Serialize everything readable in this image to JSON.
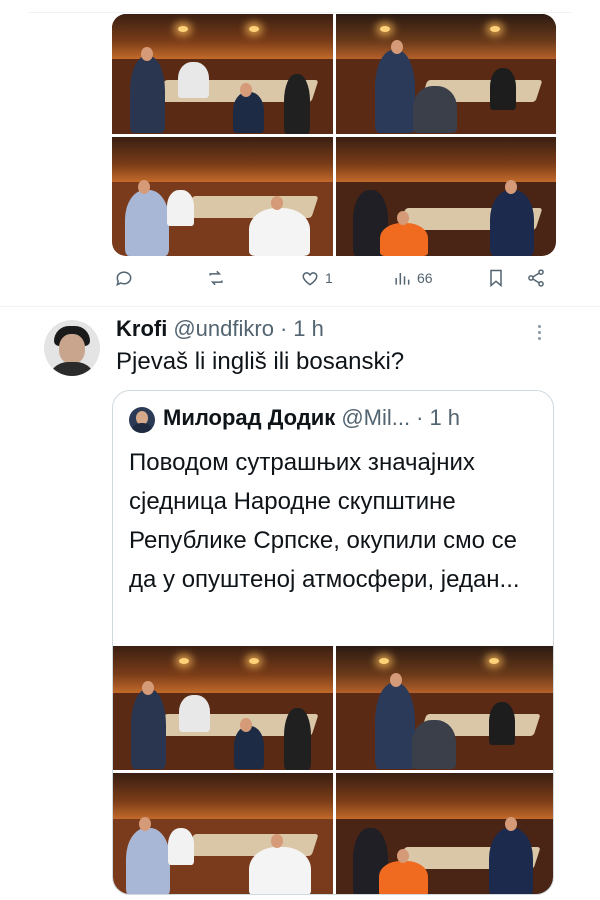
{
  "actions": {
    "reply_count": "",
    "repost_count": "",
    "like_count": "1",
    "views_count": "66"
  },
  "reply_tweet": {
    "author_name": "Krofi",
    "handle": "@undfikro",
    "separator": "·",
    "time": "1 h",
    "text": "Pjevaš li ingliš ili bosanski?"
  },
  "quoted_tweet": {
    "author_name": "Милорад Додик",
    "handle": "@Mil...",
    "separator": "·",
    "time": "1 h",
    "text": "Поводом сутрашњих значајних сједница Народне скупштине Републике Српске, окупили смо се да у опуштеној атмосфери, један..."
  },
  "icons": [
    "reply-icon",
    "repost-icon",
    "like-icon",
    "views-icon",
    "bookmark-icon",
    "share-icon",
    "more-icon"
  ],
  "colors": {
    "muted": "#536471",
    "text": "#0f1419",
    "border": "#cfd9de"
  }
}
